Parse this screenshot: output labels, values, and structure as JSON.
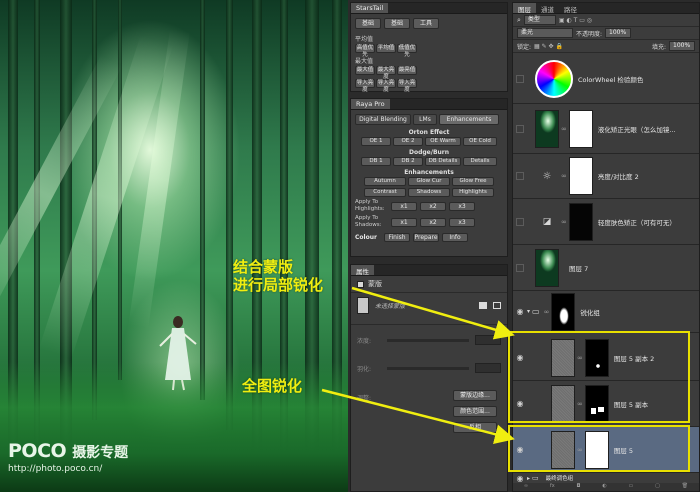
{
  "photo": {
    "watermark_logo": "POCO",
    "watermark_sub": "摄影专题",
    "watermark_url": "http://photo.poco.cn/"
  },
  "starstail": {
    "tab_title": "StarsTail",
    "buttons_top": [
      "基础",
      "基础",
      "工具"
    ],
    "groups": [
      {
        "title": "平均值",
        "buttons": [
          "高值优先",
          "平均值",
          "低值优先"
        ]
      },
      {
        "title": "最大值",
        "buttons": [
          "最大值",
          "最大亮度",
          "最亮值"
        ]
      },
      {
        "title": "",
        "buttons": [
          "导入亮度",
          "导入亮度",
          "导入亮度"
        ]
      }
    ]
  },
  "raya": {
    "tab_title": "Raya Pro",
    "tabs": [
      "Digital Blending",
      "LMs",
      "Enhancements"
    ],
    "orton_title": "Orton Effect",
    "orton_buttons": [
      "OE 1",
      "OE 2",
      "OE Warm",
      "OE Cold"
    ],
    "dodge_title": "Dodge/Burn",
    "dodge_buttons": [
      "DB 1",
      "DB 2",
      "DB Details",
      "Details"
    ],
    "enh_title": "Enhancements",
    "enh_row1": [
      "Autumn",
      "Glow Cur",
      "Glow Free"
    ],
    "enh_row2": [
      "Contrast",
      "Shadows",
      "Highlights"
    ],
    "apply_highlights": "Apply To Highlights:",
    "apply_shadows": "Apply To Shadows:",
    "apply_buttons": [
      "x1",
      "x2",
      "x3"
    ],
    "bottom_buttons": [
      "Colour",
      "Finish",
      "Prepare",
      "Info"
    ]
  },
  "properties": {
    "tab_title": "属性",
    "type_label": "蒙版",
    "mask_name": "未选择蒙版",
    "density_label": "浓度:",
    "feather_label": "羽化:",
    "refine_label": "调整:",
    "btn_mask_edge": "蒙版边缘...",
    "btn_color_range": "颜色范围...",
    "btn_invert": "反相"
  },
  "layers": {
    "tabs": [
      "图层",
      "通道",
      "路径"
    ],
    "kind_label": "类型",
    "blend_mode": "柔光",
    "opacity_label": "不透明度:",
    "opacity_value": "100%",
    "lock_label": "锁定:",
    "fill_label": "填充:",
    "fill_value": "100%",
    "items": [
      {
        "name": "ColorWheel 检验颜色"
      },
      {
        "name": "液化矫正光眼（怎么加镜..."
      },
      {
        "name": "亮度/对比度 2"
      },
      {
        "name": "轻度肤色矫正（可有可无）"
      },
      {
        "name": "图层 7"
      },
      {
        "name": "锐化组"
      },
      {
        "name": "图层 5 副本 2"
      },
      {
        "name": "图层 5 副本"
      },
      {
        "name": "图层 5"
      },
      {
        "name": "最终调色组"
      }
    ]
  },
  "annotations": {
    "local_sharpen": "结合蒙版\n进行局部锐化",
    "global_sharpen": "全图锐化"
  },
  "colors": {
    "highlight": "#e8e000",
    "selected_layer": "#5a6a82"
  }
}
